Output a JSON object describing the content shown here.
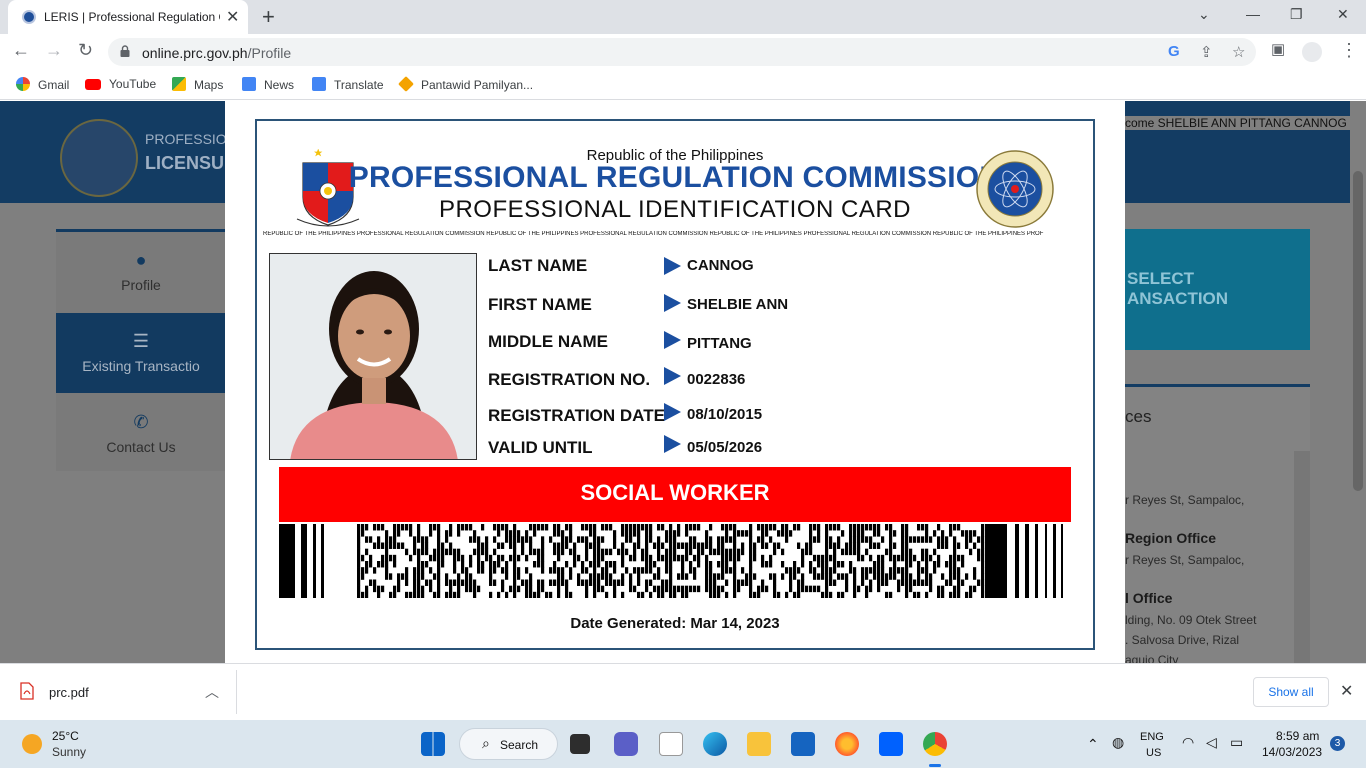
{
  "browser": {
    "tab_title": "LERIS | Professional Regulation C",
    "url_host": "online.prc.gov.ph",
    "url_path": "/Profile",
    "bookmarks": [
      "Gmail",
      "YouTube",
      "Maps",
      "News",
      "Translate",
      "Pantawid Pamilyan..."
    ]
  },
  "site": {
    "header_line1": "PROFESSION",
    "header_line2": "LICENSU",
    "welcome": "come SHELBIE ANN PITTANG CANNOG",
    "sidebar": [
      {
        "label": "Profile",
        "icon": "user-icon"
      },
      {
        "label": "Existing Transactio",
        "icon": "list-icon"
      },
      {
        "label": "Contact Us",
        "icon": "phone-icon"
      }
    ],
    "select_line1": "SELECT",
    "select_line2": "ANSACTION",
    "offices_title": "ces",
    "offices": [
      "r Reyes St, Sampaloc,",
      "Region Office",
      "r Reyes St, Sampaloc,",
      "l Office",
      "lding, No. 09 Otek Street",
      ". Salvosa Drive, Rizal",
      "aguio City"
    ]
  },
  "card": {
    "republic": "Republic of the Philippines",
    "commission": "PROFESSIONAL REGULATION COMMISSION",
    "card_title": "PROFESSIONAL IDENTIFICATION CARD",
    "microstrip": "REPUBLIC OF THE PHILIPPINES PROFESSIONAL REGULATION COMMISSION REPUBLIC OF THE PHILIPPINES PROFESSIONAL REGULATION COMMISSION REPUBLIC OF THE PHILIPPINES PROFESSIONAL REGULATION COMMISSION REPUBLIC OF THE PHILIPPINES PROF",
    "fields": [
      {
        "label": "LAST NAME",
        "value": "CANNOG"
      },
      {
        "label": "FIRST NAME",
        "value": "SHELBIE ANN"
      },
      {
        "label": "MIDDLE NAME",
        "value": "PITTANG"
      },
      {
        "label": "REGISTRATION NO.",
        "value": "0022836"
      },
      {
        "label": "REGISTRATION DATE",
        "value": "08/10/2015"
      },
      {
        "label": "VALID UNTIL",
        "value": "05/05/2026"
      }
    ],
    "profession": "SOCIAL WORKER",
    "date_generated": "Date Generated: Mar 14, 2023",
    "accent_blue": "#1b4fa0",
    "profession_red": "#ff0000"
  },
  "downloads": {
    "file": "prc.pdf",
    "show_all": "Show all"
  },
  "taskbar": {
    "temperature": "25°C",
    "condition": "Sunny",
    "search": "Search",
    "lang1": "ENG",
    "lang2": "US",
    "time": "8:59 am",
    "date": "14/03/2023",
    "notifications": "3"
  }
}
